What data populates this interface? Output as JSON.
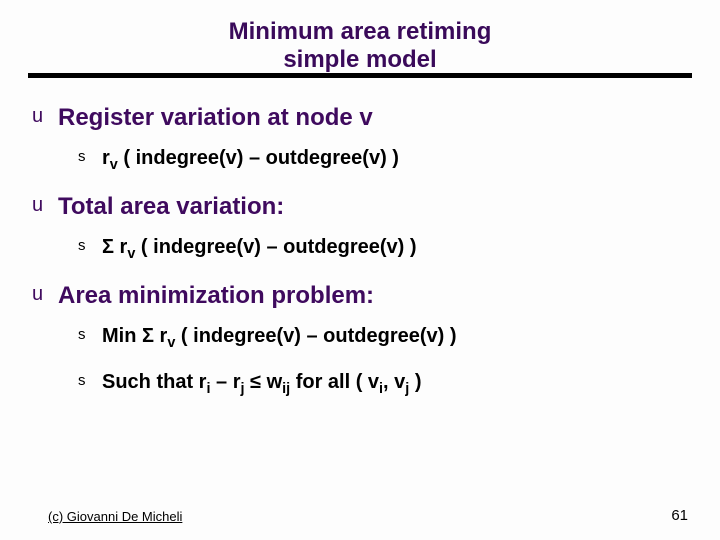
{
  "title_line1": "Minimum area retiming",
  "title_line2": "simple model",
  "items": {
    "h1": "Register variation at node v",
    "h1_sub1": "r<span class=\"sub\">v</span> ( indegree(v) – outdegree(v) )",
    "h2": "Total area variation:",
    "h2_sub1": "Σ r<span class=\"sub\">v</span> ( indegree(v) – outdegree(v) )",
    "h3": "Area minimization problem:",
    "h3_sub1": "Min Σ r<span class=\"sub\">v</span> ( indegree(v) – outdegree(v) )",
    "h3_sub2": "Such that r<span class=\"sub\">i</span> – r<span class=\"sub\">j</span>  ≤ w<span class=\"sub\">ij</span>  for all ( v<span class=\"sub\">i</span>, v<span class=\"sub\">j</span> )"
  },
  "footer": "(c) Giovanni De Micheli",
  "page": "61",
  "bullets": {
    "lvl1": "u",
    "lvl2": "s"
  }
}
